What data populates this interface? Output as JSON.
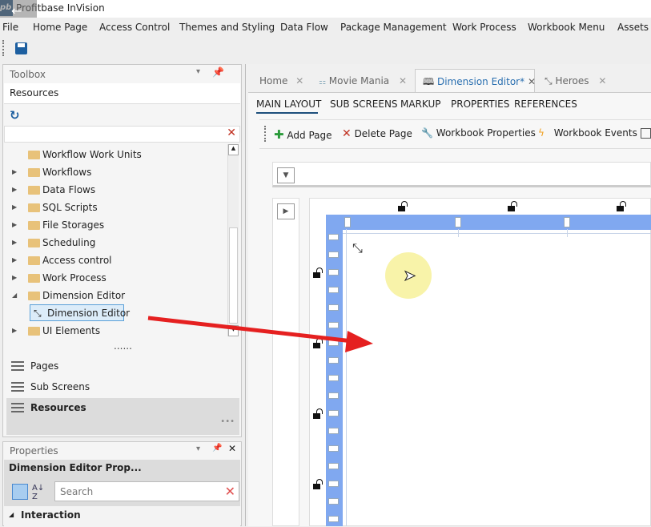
{
  "app": {
    "title": "Profitbase InVision",
    "logo": "pb"
  },
  "menu": [
    "File",
    "Home Page",
    "Access Control",
    "Themes and Styling",
    "Data Flow",
    "Package Management",
    "Work Process",
    "Workbook Menu",
    "Assets"
  ],
  "toolbox": {
    "title": "Toolbox",
    "section": "Resources",
    "tree": [
      {
        "label": "Workflow Work Units",
        "expander": false
      },
      {
        "label": "Workflows",
        "expander": true
      },
      {
        "label": "Data Flows",
        "expander": true
      },
      {
        "label": "SQL Scripts",
        "expander": true
      },
      {
        "label": "File Storages",
        "expander": true
      },
      {
        "label": "Scheduling",
        "expander": true
      },
      {
        "label": "Access control",
        "expander": true
      },
      {
        "label": "Work Process",
        "expander": true
      },
      {
        "label": "Dimension Editor",
        "expander": true,
        "expanded": true
      },
      {
        "label": "Dimension Editor",
        "child": true,
        "selected": true
      },
      {
        "label": "UI Elements",
        "expander": true
      }
    ],
    "more": "......",
    "nav": [
      "Pages",
      "Sub Screens",
      "Resources"
    ],
    "nav_selected": "Resources",
    "overflow": "•••"
  },
  "properties": {
    "title": "Properties",
    "header": "Dimension Editor Prop...",
    "search_placeholder": "Search",
    "category": "Interaction"
  },
  "tabs": [
    {
      "label": "Home"
    },
    {
      "label": "Movie Mania"
    },
    {
      "label": "Dimension Editor*",
      "active": true
    },
    {
      "label": "Heroes"
    }
  ],
  "subtabs": [
    "MAIN LAYOUT",
    "SUB SCREENS",
    "MARKUP",
    "PROPERTIES",
    "REFERENCES"
  ],
  "toolbar": [
    "Add Page",
    "Delete Page",
    "Workbook Properties",
    "Workbook Events"
  ],
  "colors": {
    "accent": "#2a6fb0",
    "ruler": "#80a8f0",
    "arrow": "#e52020",
    "cursor_highlight": "#f7f19a"
  }
}
